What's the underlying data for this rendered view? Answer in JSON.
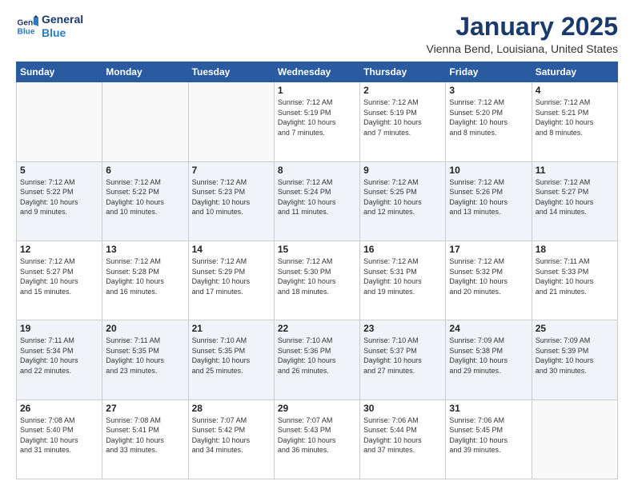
{
  "logo": {
    "line1": "General",
    "line2": "Blue"
  },
  "title": "January 2025",
  "location": "Vienna Bend, Louisiana, United States",
  "weekdays": [
    "Sunday",
    "Monday",
    "Tuesday",
    "Wednesday",
    "Thursday",
    "Friday",
    "Saturday"
  ],
  "weeks": [
    [
      {
        "day": "",
        "info": ""
      },
      {
        "day": "",
        "info": ""
      },
      {
        "day": "",
        "info": ""
      },
      {
        "day": "1",
        "info": "Sunrise: 7:12 AM\nSunset: 5:19 PM\nDaylight: 10 hours\nand 7 minutes."
      },
      {
        "day": "2",
        "info": "Sunrise: 7:12 AM\nSunset: 5:19 PM\nDaylight: 10 hours\nand 7 minutes."
      },
      {
        "day": "3",
        "info": "Sunrise: 7:12 AM\nSunset: 5:20 PM\nDaylight: 10 hours\nand 8 minutes."
      },
      {
        "day": "4",
        "info": "Sunrise: 7:12 AM\nSunset: 5:21 PM\nDaylight: 10 hours\nand 8 minutes."
      }
    ],
    [
      {
        "day": "5",
        "info": "Sunrise: 7:12 AM\nSunset: 5:22 PM\nDaylight: 10 hours\nand 9 minutes."
      },
      {
        "day": "6",
        "info": "Sunrise: 7:12 AM\nSunset: 5:22 PM\nDaylight: 10 hours\nand 10 minutes."
      },
      {
        "day": "7",
        "info": "Sunrise: 7:12 AM\nSunset: 5:23 PM\nDaylight: 10 hours\nand 10 minutes."
      },
      {
        "day": "8",
        "info": "Sunrise: 7:12 AM\nSunset: 5:24 PM\nDaylight: 10 hours\nand 11 minutes."
      },
      {
        "day": "9",
        "info": "Sunrise: 7:12 AM\nSunset: 5:25 PM\nDaylight: 10 hours\nand 12 minutes."
      },
      {
        "day": "10",
        "info": "Sunrise: 7:12 AM\nSunset: 5:26 PM\nDaylight: 10 hours\nand 13 minutes."
      },
      {
        "day": "11",
        "info": "Sunrise: 7:12 AM\nSunset: 5:27 PM\nDaylight: 10 hours\nand 14 minutes."
      }
    ],
    [
      {
        "day": "12",
        "info": "Sunrise: 7:12 AM\nSunset: 5:27 PM\nDaylight: 10 hours\nand 15 minutes."
      },
      {
        "day": "13",
        "info": "Sunrise: 7:12 AM\nSunset: 5:28 PM\nDaylight: 10 hours\nand 16 minutes."
      },
      {
        "day": "14",
        "info": "Sunrise: 7:12 AM\nSunset: 5:29 PM\nDaylight: 10 hours\nand 17 minutes."
      },
      {
        "day": "15",
        "info": "Sunrise: 7:12 AM\nSunset: 5:30 PM\nDaylight: 10 hours\nand 18 minutes."
      },
      {
        "day": "16",
        "info": "Sunrise: 7:12 AM\nSunset: 5:31 PM\nDaylight: 10 hours\nand 19 minutes."
      },
      {
        "day": "17",
        "info": "Sunrise: 7:12 AM\nSunset: 5:32 PM\nDaylight: 10 hours\nand 20 minutes."
      },
      {
        "day": "18",
        "info": "Sunrise: 7:11 AM\nSunset: 5:33 PM\nDaylight: 10 hours\nand 21 minutes."
      }
    ],
    [
      {
        "day": "19",
        "info": "Sunrise: 7:11 AM\nSunset: 5:34 PM\nDaylight: 10 hours\nand 22 minutes."
      },
      {
        "day": "20",
        "info": "Sunrise: 7:11 AM\nSunset: 5:35 PM\nDaylight: 10 hours\nand 23 minutes."
      },
      {
        "day": "21",
        "info": "Sunrise: 7:10 AM\nSunset: 5:35 PM\nDaylight: 10 hours\nand 25 minutes."
      },
      {
        "day": "22",
        "info": "Sunrise: 7:10 AM\nSunset: 5:36 PM\nDaylight: 10 hours\nand 26 minutes."
      },
      {
        "day": "23",
        "info": "Sunrise: 7:10 AM\nSunset: 5:37 PM\nDaylight: 10 hours\nand 27 minutes."
      },
      {
        "day": "24",
        "info": "Sunrise: 7:09 AM\nSunset: 5:38 PM\nDaylight: 10 hours\nand 29 minutes."
      },
      {
        "day": "25",
        "info": "Sunrise: 7:09 AM\nSunset: 5:39 PM\nDaylight: 10 hours\nand 30 minutes."
      }
    ],
    [
      {
        "day": "26",
        "info": "Sunrise: 7:08 AM\nSunset: 5:40 PM\nDaylight: 10 hours\nand 31 minutes."
      },
      {
        "day": "27",
        "info": "Sunrise: 7:08 AM\nSunset: 5:41 PM\nDaylight: 10 hours\nand 33 minutes."
      },
      {
        "day": "28",
        "info": "Sunrise: 7:07 AM\nSunset: 5:42 PM\nDaylight: 10 hours\nand 34 minutes."
      },
      {
        "day": "29",
        "info": "Sunrise: 7:07 AM\nSunset: 5:43 PM\nDaylight: 10 hours\nand 36 minutes."
      },
      {
        "day": "30",
        "info": "Sunrise: 7:06 AM\nSunset: 5:44 PM\nDaylight: 10 hours\nand 37 minutes."
      },
      {
        "day": "31",
        "info": "Sunrise: 7:06 AM\nSunset: 5:45 PM\nDaylight: 10 hours\nand 39 minutes."
      },
      {
        "day": "",
        "info": ""
      }
    ]
  ]
}
